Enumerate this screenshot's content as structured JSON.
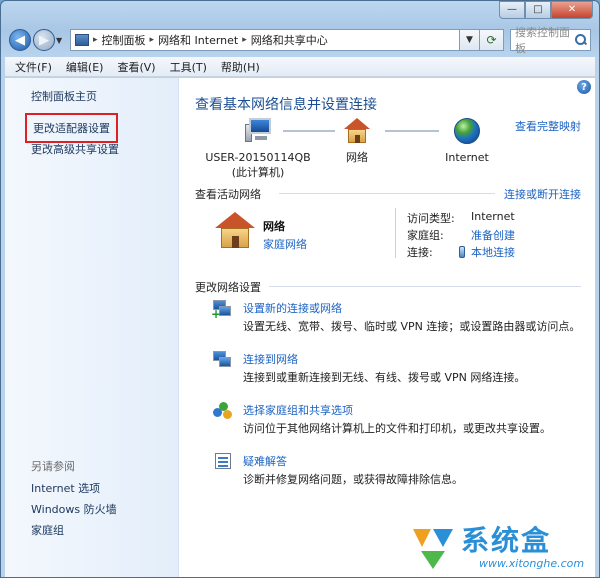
{
  "window": {
    "caption": {
      "minimize_label": "—",
      "maximize_label": "□",
      "close_label": "✕"
    }
  },
  "navbar": {
    "back_glyph": "◀",
    "forward_glyph": "▶",
    "recent_glyph": "▼",
    "breadcrumb": [
      "控制面板",
      "网络和 Internet",
      "网络和共享中心"
    ],
    "separator_glyph": "▸",
    "dropdown_glyph": "▼",
    "refresh_glyph": "⟳",
    "search_placeholder": "搜索控制面板"
  },
  "menubar": {
    "items": [
      "文件(F)",
      "编辑(E)",
      "查看(V)",
      "工具(T)",
      "帮助(H)"
    ]
  },
  "sidebar": {
    "home_link": "控制面板主页",
    "adapter_link": "更改适配器设置",
    "advanced_sharing_link": "更改高级共享设置",
    "see_also_heading": "另请参阅",
    "see_also_items": [
      "Internet 选项",
      "Windows 防火墙",
      "家庭组"
    ]
  },
  "main": {
    "help_glyph": "?",
    "title": "查看基本网络信息并设置连接",
    "full_map_link": "查看完整映射",
    "map": {
      "computer_name": "USER-20150114QB",
      "computer_sub": "(此计算机)",
      "network_label": "网络",
      "internet_label": "Internet"
    },
    "active_networks": {
      "heading": "查看活动网络",
      "connect_link": "连接或断开连接",
      "network_name": "网络",
      "network_type": "家庭网络",
      "access_type_key": "访问类型:",
      "access_type_value": "Internet",
      "homegroup_key": "家庭组:",
      "homegroup_value": "准备创建",
      "connections_key": "连接:",
      "connections_value": "本地连接"
    },
    "change_settings": {
      "heading": "更改网络设置",
      "tasks": [
        {
          "title": "设置新的连接或网络",
          "desc": "设置无线、宽带、拨号、临时或 VPN 连接；或设置路由器或访问点。",
          "icon": "network-setup-icon"
        },
        {
          "title": "连接到网络",
          "desc": "连接到或重新连接到无线、有线、拨号或 VPN 网络连接。",
          "icon": "connect-network-icon"
        },
        {
          "title": "选择家庭组和共享选项",
          "desc": "访问位于其他网络计算机上的文件和打印机，或更改共享设置。",
          "icon": "homegroup-icon"
        },
        {
          "title": "疑难解答",
          "desc": "诊断并修复网络问题，或获得故障排除信息。",
          "icon": "troubleshoot-icon"
        }
      ]
    }
  },
  "watermark": {
    "text": "系统盒",
    "url": "www.xitonghe.com"
  },
  "colors": {
    "link": "#1c63c3",
    "title": "#1b4f93",
    "highlight_box": "#e02020"
  }
}
